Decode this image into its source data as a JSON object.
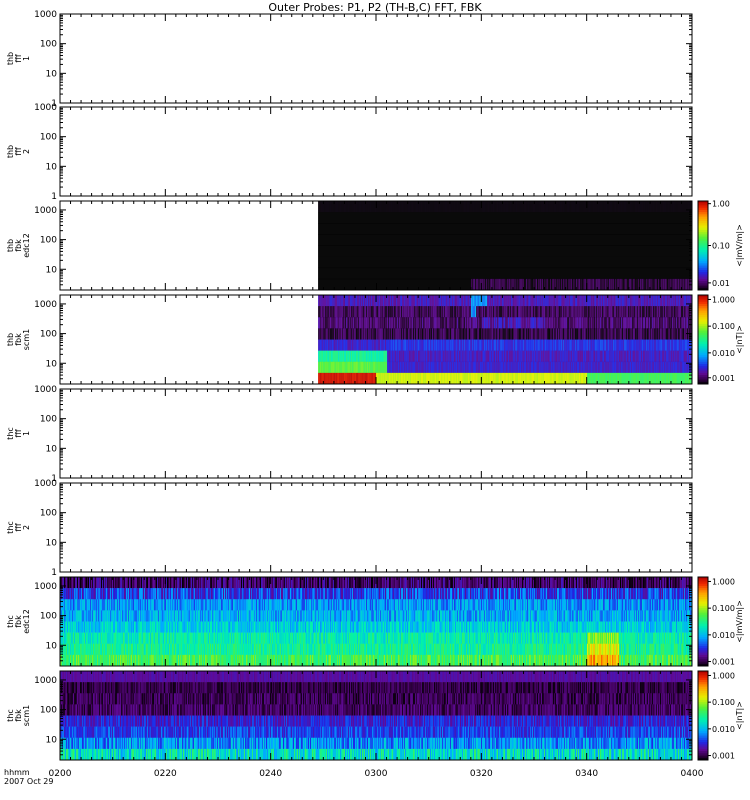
{
  "title": "Outer Probes: P1, P2 (TH-B,C) FFT, FBK",
  "time_axis": {
    "label_line1": "hhmm",
    "label_line2": "2007 Oct 29",
    "ticks": [
      "0200",
      "0220",
      "0240",
      "0300",
      "0320",
      "0340",
      "0400"
    ],
    "range_minutes": [
      0,
      120
    ]
  },
  "chart_data": [
    {
      "type": "heatmap",
      "ylabel": [
        "thb",
        "fff",
        "1"
      ],
      "yscale": "log",
      "ylim": [
        1,
        1000
      ],
      "yticks": [
        "1",
        "10",
        "100",
        "1000"
      ],
      "has_data": false,
      "colorbar": null
    },
    {
      "type": "heatmap",
      "ylabel": [
        "thb",
        "fff",
        "2"
      ],
      "yscale": "log",
      "ylim": [
        1,
        1000
      ],
      "yticks": [
        "1",
        "10",
        "100",
        "1000"
      ],
      "has_data": false,
      "colorbar": null
    },
    {
      "type": "heatmap",
      "ylabel": [
        "thb",
        "fbk",
        "edc12"
      ],
      "yscale": "log",
      "ylim": [
        2,
        2000
      ],
      "yticks": [
        "10",
        "100",
        "1000"
      ],
      "has_data": true,
      "data_start_minute": 49,
      "bands": [
        {
          "level": 0.006,
          "noise": 0.001,
          "blocks": []
        },
        {
          "level": 0.0,
          "noise": 0.0,
          "blocks": [
            {
              "from": 49,
              "to": 120,
              "level": 0.0
            }
          ]
        },
        {
          "level": 0.0,
          "noise": 0.0,
          "blocks": []
        },
        {
          "level": 0.0,
          "noise": 0.0,
          "blocks": []
        },
        {
          "level": 0.0,
          "noise": 0.0,
          "blocks": []
        },
        {
          "level": 0.0,
          "noise": 0.0,
          "blocks": []
        },
        {
          "level": 0.0,
          "noise": 0.0,
          "blocks": []
        },
        {
          "level": 0.0,
          "noise": 0.0,
          "blocks": [
            {
              "from": 78,
              "to": 120,
              "level": 0.04,
              "noise": 0.04
            }
          ]
        }
      ],
      "colorbar": {
        "label": "<|mV/m|>",
        "ticks": [
          "1.00",
          "0.10",
          "0.01"
        ],
        "tick_pos": [
          0.03,
          0.5,
          0.92
        ]
      }
    },
    {
      "type": "heatmap",
      "ylabel": [
        "thb",
        "fbk",
        "scm1"
      ],
      "yscale": "log",
      "ylim": [
        2,
        2000
      ],
      "yticks": [
        "10",
        "100",
        "1000"
      ],
      "has_data": true,
      "data_start_minute": 49,
      "bands": [
        {
          "level": 0.15,
          "noise": 0.04,
          "blocks": [
            {
              "from": 78,
              "to": 81,
              "level": 0.3
            }
          ]
        },
        {
          "level": 0.06,
          "noise": 0.05,
          "blocks": [
            {
              "from": 78,
              "to": 79,
              "level": 0.3
            }
          ]
        },
        {
          "level": 0.08,
          "noise": 0.06,
          "blocks": [
            {
              "from": 80,
              "to": 92,
              "level": 0.14
            }
          ]
        },
        {
          "level": 0.05,
          "noise": 0.05,
          "blocks": []
        },
        {
          "level": 0.17,
          "noise": 0.04,
          "blocks": [
            {
              "from": 62,
              "to": 120,
              "level": 0.2
            }
          ]
        },
        {
          "level": 0.47,
          "noise": 0.04,
          "blocks": [
            {
              "from": 62,
              "to": 120,
              "level": 0.16
            }
          ]
        },
        {
          "level": 0.58,
          "noise": 0.03,
          "blocks": [
            {
              "from": 62,
              "to": 120,
              "level": 0.17
            }
          ]
        },
        {
          "level": 0.96,
          "noise": 0.02,
          "blocks": [
            {
              "from": 60,
              "to": 120,
              "level": 0.68
            },
            {
              "from": 100,
              "to": 120,
              "level": 0.55
            }
          ]
        }
      ],
      "colorbar": {
        "label": "<|nT|>",
        "ticks": [
          "1.000",
          "0.100",
          "0.010",
          "0.001"
        ],
        "tick_pos": [
          0.05,
          0.35,
          0.65,
          0.93
        ]
      }
    },
    {
      "type": "heatmap",
      "ylabel": [
        "thc",
        "fff",
        "1"
      ],
      "yscale": "log",
      "ylim": [
        1,
        1000
      ],
      "yticks": [
        "1",
        "10",
        "100",
        "1000"
      ],
      "has_data": false,
      "colorbar": null
    },
    {
      "type": "heatmap",
      "ylabel": [
        "thc",
        "fff",
        "2"
      ],
      "yscale": "log",
      "ylim": [
        1,
        1000
      ],
      "yticks": [
        "1",
        "10",
        "100",
        "1000"
      ],
      "has_data": false,
      "colorbar": null
    },
    {
      "type": "heatmap",
      "ylabel": [
        "thc",
        "fbk",
        "edc12"
      ],
      "yscale": "log",
      "ylim": [
        2,
        2000
      ],
      "yticks": [
        "10",
        "100",
        "1000"
      ],
      "has_data": true,
      "data_start_minute": 0,
      "bands": [
        {
          "level": 0.08,
          "noise": 0.08,
          "blocks": []
        },
        {
          "level": 0.22,
          "noise": 0.1,
          "blocks": []
        },
        {
          "level": 0.3,
          "noise": 0.08,
          "blocks": []
        },
        {
          "level": 0.33,
          "noise": 0.08,
          "blocks": []
        },
        {
          "level": 0.38,
          "noise": 0.08,
          "blocks": []
        },
        {
          "level": 0.45,
          "noise": 0.07,
          "blocks": [
            {
              "from": 100,
              "to": 106,
              "level": 0.62
            }
          ]
        },
        {
          "level": 0.48,
          "noise": 0.07,
          "blocks": [
            {
              "from": 100,
              "to": 106,
              "level": 0.7
            }
          ]
        },
        {
          "level": 0.55,
          "noise": 0.08,
          "blocks": [
            {
              "from": 100,
              "to": 106,
              "level": 0.8
            }
          ]
        }
      ],
      "colorbar": {
        "label": "<|mV/m|>",
        "ticks": [
          "1.000",
          "0.100",
          "0.010",
          "0.001"
        ],
        "tick_pos": [
          0.05,
          0.35,
          0.65,
          0.95
        ]
      }
    },
    {
      "type": "heatmap",
      "ylabel": [
        "thc",
        "fbk",
        "scm1"
      ],
      "yscale": "log",
      "ylim": [
        2,
        2000
      ],
      "yticks": [
        "10",
        "100",
        "1000"
      ],
      "has_data": true,
      "data_start_minute": 0,
      "bands": [
        {
          "level": 0.13,
          "noise": 0.02,
          "blocks": []
        },
        {
          "level": 0.05,
          "noise": 0.04,
          "blocks": []
        },
        {
          "level": 0.06,
          "noise": 0.05,
          "blocks": []
        },
        {
          "level": 0.07,
          "noise": 0.05,
          "blocks": []
        },
        {
          "level": 0.18,
          "noise": 0.06,
          "blocks": []
        },
        {
          "level": 0.22,
          "noise": 0.07,
          "blocks": []
        },
        {
          "level": 0.3,
          "noise": 0.1,
          "blocks": []
        },
        {
          "level": 0.42,
          "noise": 0.12,
          "blocks": []
        }
      ],
      "colorbar": {
        "label": "<|nT|>",
        "ticks": [
          "1.000",
          "0.100",
          "0.010",
          "0.001"
        ],
        "tick_pos": [
          0.05,
          0.35,
          0.65,
          0.95
        ]
      }
    }
  ]
}
